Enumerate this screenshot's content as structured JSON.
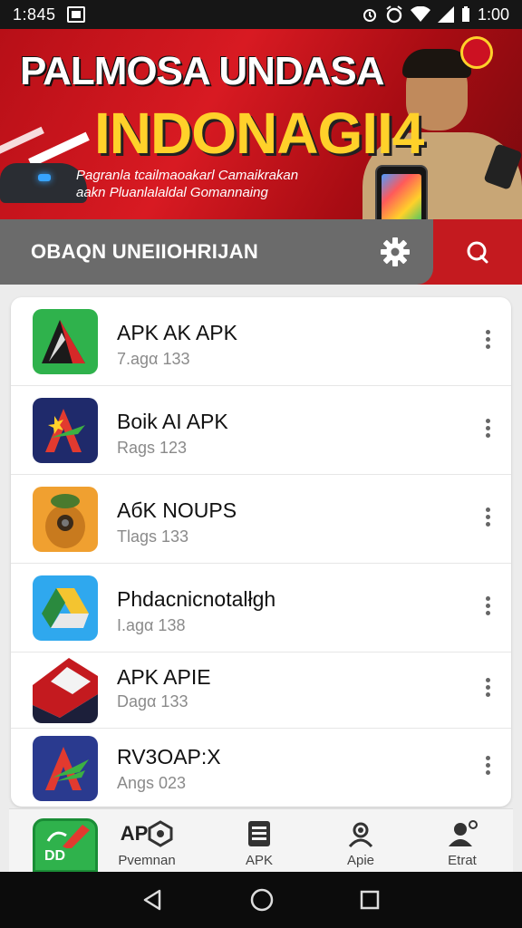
{
  "status_bar": {
    "time": "1:845",
    "right_time": "1:00"
  },
  "banner": {
    "title_line1": "PALMOSA UNDASA",
    "title_line2": "INDONAGII4",
    "subtitle_line1": "Pagranla tcailmaoakarl Camaikrakan",
    "subtitle_line2": "aakn Pluanlalaldal Gomannaing"
  },
  "header": {
    "title": "OBAQN UNEIIOHRIJAN",
    "settings_icon": "gear-icon",
    "chat_icon": "chat-icon"
  },
  "apps": [
    {
      "name": "APK AK APK",
      "meta": "7.agα 133",
      "icon": "green-a-icon",
      "colors": [
        "#2fb24c",
        "#1a1a1a"
      ]
    },
    {
      "name": "Boik AI APK",
      "meta": "Rags 123",
      "icon": "navy-a-icon",
      "colors": [
        "#1f2a6b",
        "#e23a2f"
      ]
    },
    {
      "name": "AбK NOUPS",
      "meta": "Tlags 133",
      "icon": "orange-character-icon",
      "colors": [
        "#f0a030",
        "#5a3d1f"
      ]
    },
    {
      "name": "Phdacnicnotalłgh",
      "meta": "I.agα 138",
      "icon": "drive-icon",
      "colors": [
        "#2fa8ee",
        "#f4c430"
      ]
    },
    {
      "name": "APK APIE",
      "meta": "Dagα 133",
      "icon": "red-book-icon",
      "colors": [
        "#c41a1f",
        "#1c1f3a"
      ]
    },
    {
      "name": "RV3OAP:X",
      "meta": "Angs 023",
      "icon": "navy-a-green-icon",
      "colors": [
        "#2a3a8f",
        "#3cb043"
      ]
    }
  ],
  "bottom_nav": {
    "app_badge": "DD",
    "items": [
      {
        "label": "Pvemnan",
        "icon": "hex-icon",
        "prefix": "AP"
      },
      {
        "label": "APK",
        "icon": "list-icon"
      },
      {
        "label": "Apie",
        "icon": "user-icon"
      },
      {
        "label": "Etrat",
        "icon": "account-icon"
      }
    ]
  },
  "colors": {
    "accent_red": "#c41a1f",
    "header_grey": "#6b6b6b",
    "banner_yellow": "#ffd12a"
  }
}
